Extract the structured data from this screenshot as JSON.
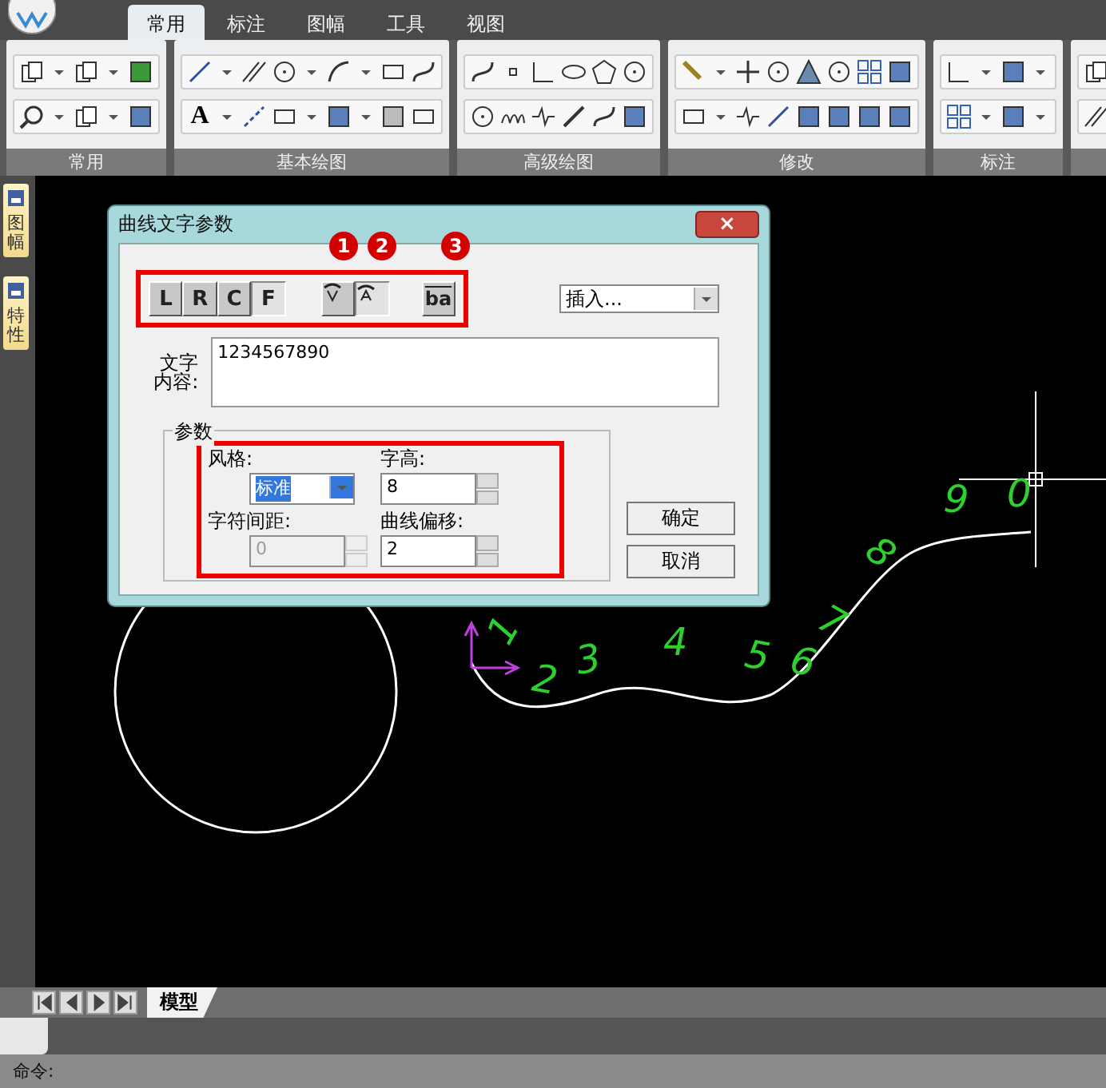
{
  "tabs": [
    {
      "label": "常用",
      "selected": true
    },
    {
      "label": "标注",
      "selected": false
    },
    {
      "label": "图幅",
      "selected": false
    },
    {
      "label": "工具",
      "selected": false
    },
    {
      "label": "视图",
      "selected": false
    }
  ],
  "ribbon": {
    "text_tool_glyph": "A",
    "groups": [
      {
        "label": "常用"
      },
      {
        "label": "基本绘图"
      },
      {
        "label": "高级绘图"
      },
      {
        "label": "修改"
      },
      {
        "label": "标注"
      }
    ]
  },
  "side_tabs": [
    {
      "label": "图幅"
    },
    {
      "label": "特性"
    }
  ],
  "canvas": {
    "curve_digits": [
      "1",
      "2",
      "3",
      "4",
      "5",
      "6",
      "7",
      "8",
      "9",
      "0"
    ]
  },
  "dialog": {
    "title": "曲线文字参数",
    "close": "×",
    "align_buttons": [
      {
        "label": "L",
        "pressed": false
      },
      {
        "label": "R",
        "pressed": false
      },
      {
        "label": "C",
        "pressed": false
      },
      {
        "label": "F",
        "pressed": true
      }
    ],
    "direction_buttons": [
      {
        "kind": "below",
        "pressed": false,
        "badge": "1"
      },
      {
        "kind": "above",
        "pressed": true,
        "badge": "2"
      },
      {
        "kind": "reverse",
        "pressed": false,
        "badge": "3",
        "text": "ba"
      }
    ],
    "insert_dropdown": {
      "value": "插入..."
    },
    "content_label": [
      "文字",
      "内容:"
    ],
    "content_value": "1234567890",
    "group_legend": "参数",
    "fields": [
      {
        "label": "风格:",
        "kind": "dropdown",
        "value": "标准",
        "disabled": false,
        "selected": true
      },
      {
        "label": "字高:",
        "kind": "spinner",
        "value": "8",
        "disabled": false,
        "selected": false
      },
      {
        "label": "字符间距:",
        "kind": "spinner",
        "value": "0",
        "disabled": true,
        "selected": false
      },
      {
        "label": "曲线偏移:",
        "kind": "spinner",
        "value": "2",
        "disabled": false,
        "selected": false
      }
    ],
    "buttons": [
      "确定",
      "取消"
    ]
  },
  "layout_tab": "模型",
  "command_prompt": "命令:"
}
